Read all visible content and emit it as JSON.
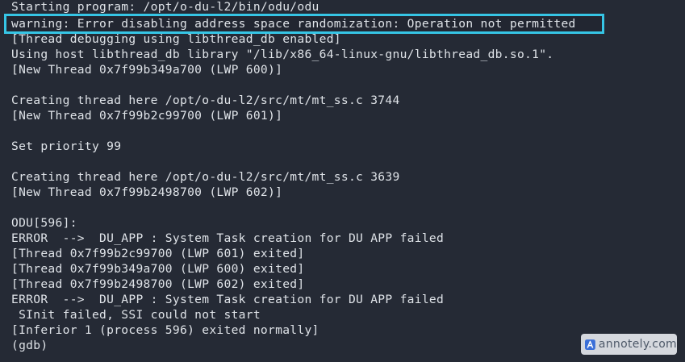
{
  "terminal": {
    "lines": [
      "Starting program: /opt/o-du-l2/bin/odu/odu",
      "warning: Error disabling address space randomization: Operation not permitted",
      "[Thread debugging using libthread_db enabled]",
      "Using host libthread_db library \"/lib/x86_64-linux-gnu/libthread_db.so.1\".",
      "[New Thread 0x7f99b349a700 (LWP 600)]",
      "",
      "Creating thread here /opt/o-du-l2/src/mt/mt_ss.c 3744",
      "[New Thread 0x7f99b2c99700 (LWP 601)]",
      "",
      "Set priority 99",
      "",
      "Creating thread here /opt/o-du-l2/src/mt/mt_ss.c 3639",
      "[New Thread 0x7f99b2498700 (LWP 602)]",
      "",
      "ODU[596]:",
      "ERROR  -->  DU_APP : System Task creation for DU APP failed",
      "[Thread 0x7f99b2c99700 (LWP 601) exited]",
      "[Thread 0x7f99b349a700 (LWP 600) exited]",
      "[Thread 0x7f99b2498700 (LWP 602) exited]",
      "ERROR  -->  DU_APP : System Task creation for DU APP failed",
      " SInit failed, SSI could not start",
      "[Inferior 1 (process 596) exited normally]",
      "(gdb)"
    ]
  },
  "colors": {
    "background": "#252a35",
    "text": "#dfe3e8",
    "highlight_border": "#36c5e5"
  },
  "watermark": {
    "text": "annotely.com",
    "icon": "annotely-logo-icon"
  }
}
